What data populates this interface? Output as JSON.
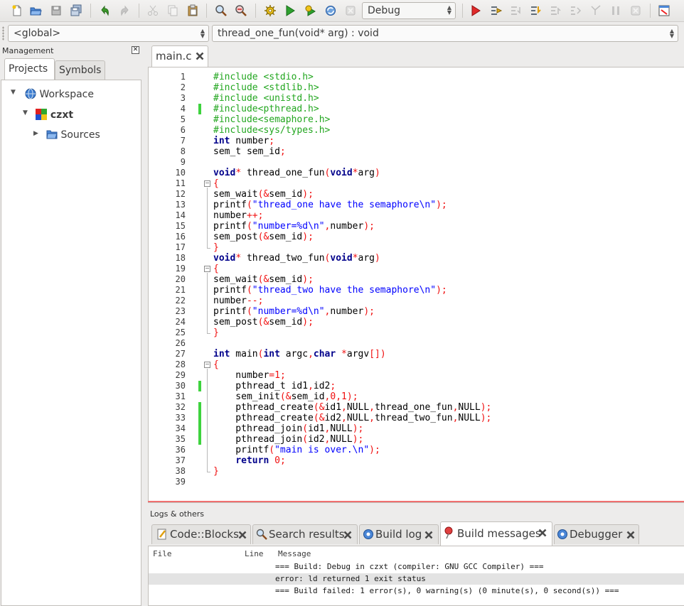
{
  "toolbar": {
    "build_target": "Debug",
    "buttons": [
      "new-file",
      "open",
      "save",
      "save-all",
      "undo",
      "redo",
      "cut",
      "copy",
      "paste",
      "find",
      "replace",
      "build",
      "run",
      "build-and-run",
      "rebuild",
      "abort",
      "debug-run",
      "run-to-cursor",
      "next-line",
      "step-into",
      "step-out",
      "next-instruction",
      "step-instruction",
      "break",
      "stop-debugger",
      "debug-windows"
    ]
  },
  "codecompletion": {
    "scope": "<global>",
    "function": "thread_one_fun(void* arg) : void"
  },
  "management": {
    "title": "Management",
    "tabs": [
      "Projects",
      "Symbols"
    ],
    "active_tab": "Projects",
    "tree": {
      "workspace": "Workspace",
      "project": "czxt",
      "folder": "Sources"
    }
  },
  "editor": {
    "tab": "main.c",
    "lines": [
      {
        "n": "1",
        "code": "#include <stdio.h>"
      },
      {
        "n": "2",
        "code": "#include <stdlib.h>"
      },
      {
        "n": "3",
        "code": "#include <unistd.h>"
      },
      {
        "n": "4",
        "code": "#include<pthread.h>"
      },
      {
        "n": "5",
        "code": "#include<semaphore.h>"
      },
      {
        "n": "6",
        "code": "#include<sys/types.h>"
      },
      {
        "n": "7",
        "code": "int number;"
      },
      {
        "n": "8",
        "code": "sem_t sem_id;"
      },
      {
        "n": "9",
        "code": ""
      },
      {
        "n": "10",
        "code": "void* thread_one_fun(void*arg)"
      },
      {
        "n": "11",
        "code": "{"
      },
      {
        "n": "12",
        "code": "sem_wait(&sem_id);"
      },
      {
        "n": "13",
        "code": "printf(\"thread_one have the semaphore\\n\");"
      },
      {
        "n": "14",
        "code": "number++;"
      },
      {
        "n": "15",
        "code": "printf(\"number=%d\\n\",number);"
      },
      {
        "n": "16",
        "code": "sem_post(&sem_id);"
      },
      {
        "n": "17",
        "code": "}"
      },
      {
        "n": "18",
        "code": "void* thread_two_fun(void*arg)"
      },
      {
        "n": "19",
        "code": "{"
      },
      {
        "n": "20",
        "code": "sem_wait(&sem_id);"
      },
      {
        "n": "21",
        "code": "printf(\"thread_two have the semaphore\\n\");"
      },
      {
        "n": "22",
        "code": "number--;"
      },
      {
        "n": "23",
        "code": "printf(\"number=%d\\n\",number);"
      },
      {
        "n": "24",
        "code": "sem_post(&sem_id);"
      },
      {
        "n": "25",
        "code": "}"
      },
      {
        "n": "26",
        "code": ""
      },
      {
        "n": "27",
        "code": "int main(int argc,char *argv[])"
      },
      {
        "n": "28",
        "code": "{"
      },
      {
        "n": "29",
        "code": "    number=1;"
      },
      {
        "n": "30",
        "code": "    pthread_t id1,id2;"
      },
      {
        "n": "31",
        "code": "    sem_init(&sem_id,0,1);"
      },
      {
        "n": "32",
        "code": "    pthread_create(&id1,NULL,thread_one_fun,NULL);"
      },
      {
        "n": "33",
        "code": "    pthread_create(&id2,NULL,thread_two_fun,NULL);"
      },
      {
        "n": "34",
        "code": "    pthread_join(id1,NULL);"
      },
      {
        "n": "35",
        "code": "    pthread_join(id2,NULL);"
      },
      {
        "n": "36",
        "code": "    printf(\"main is over.\\n\");"
      },
      {
        "n": "37",
        "code": "    return 0;"
      },
      {
        "n": "38",
        "code": "}"
      },
      {
        "n": "39",
        "code": ""
      }
    ],
    "changed_lines": [
      "4",
      "30",
      "32",
      "33",
      "34",
      "35"
    ]
  },
  "logs": {
    "title": "Logs & others",
    "tabs": [
      "Code::Blocks",
      "Search results",
      "Build log",
      "Build messages",
      "Debugger"
    ],
    "active_tab": "Build messages",
    "columns": [
      "File",
      "Line",
      "Message"
    ],
    "rows": [
      {
        "file": "",
        "line": "",
        "message": "=== Build: Debug in czxt (compiler: GNU GCC Compiler) ==="
      },
      {
        "file": "",
        "line": "",
        "message": "error: ld returned 1 exit status"
      },
      {
        "file": "",
        "line": "",
        "message": "=== Build failed: 1 error(s), 0 warning(s) (0 minute(s), 0 second(s)) ==="
      }
    ],
    "selected_row_index": 1
  },
  "colors": {
    "keyword": "#00008b",
    "preprocessor": "#22a61f",
    "string": "#0000ff",
    "number": "#f01010",
    "change_marker": "#3ed33e",
    "selected_row": "#e3e3e3"
  }
}
